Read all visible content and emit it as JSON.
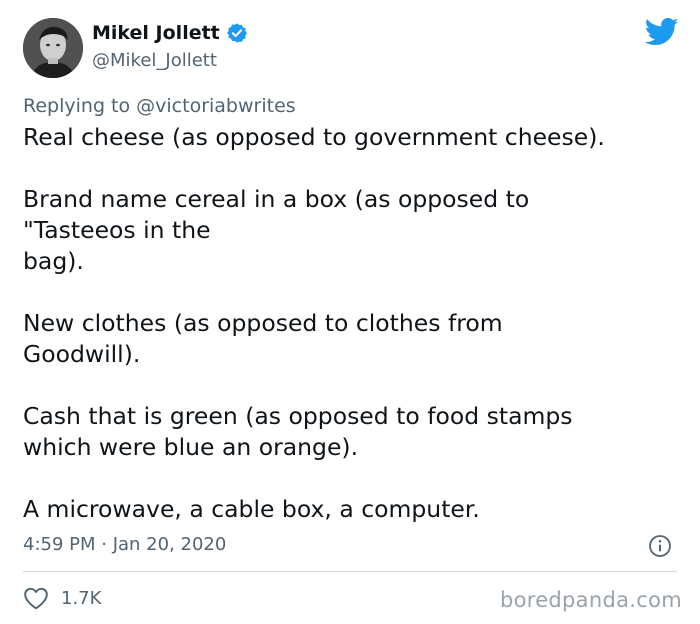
{
  "author": {
    "display_name": "Mikel Jollett",
    "handle": "@Mikel_Jollett",
    "verified_icon": "verified-badge-icon",
    "avatar_icon": "avatar"
  },
  "reply": {
    "prefix": "Replying to ",
    "mention": "@victoriabwrites"
  },
  "body": {
    "paragraphs": [
      "Real cheese (as opposed to government cheese).",
      "Brand name cereal in a box (as opposed to\n\"Tasteeos in the\nbag).",
      "New clothes (as opposed to clothes from\nGoodwill).",
      "Cash that is green (as opposed to food stamps\nwhich were blue an orange).",
      "A microwave, a cable box, a computer."
    ]
  },
  "meta": {
    "timestamp": "4:59 PM · Jan 20, 2020"
  },
  "engagement": {
    "likes": "1.7K"
  },
  "watermark": "boredpanda.com",
  "colors": {
    "text": "#0f1419",
    "secondary": "#536471",
    "twitter_blue": "#1d9bf0",
    "divider": "#cfd9de"
  }
}
